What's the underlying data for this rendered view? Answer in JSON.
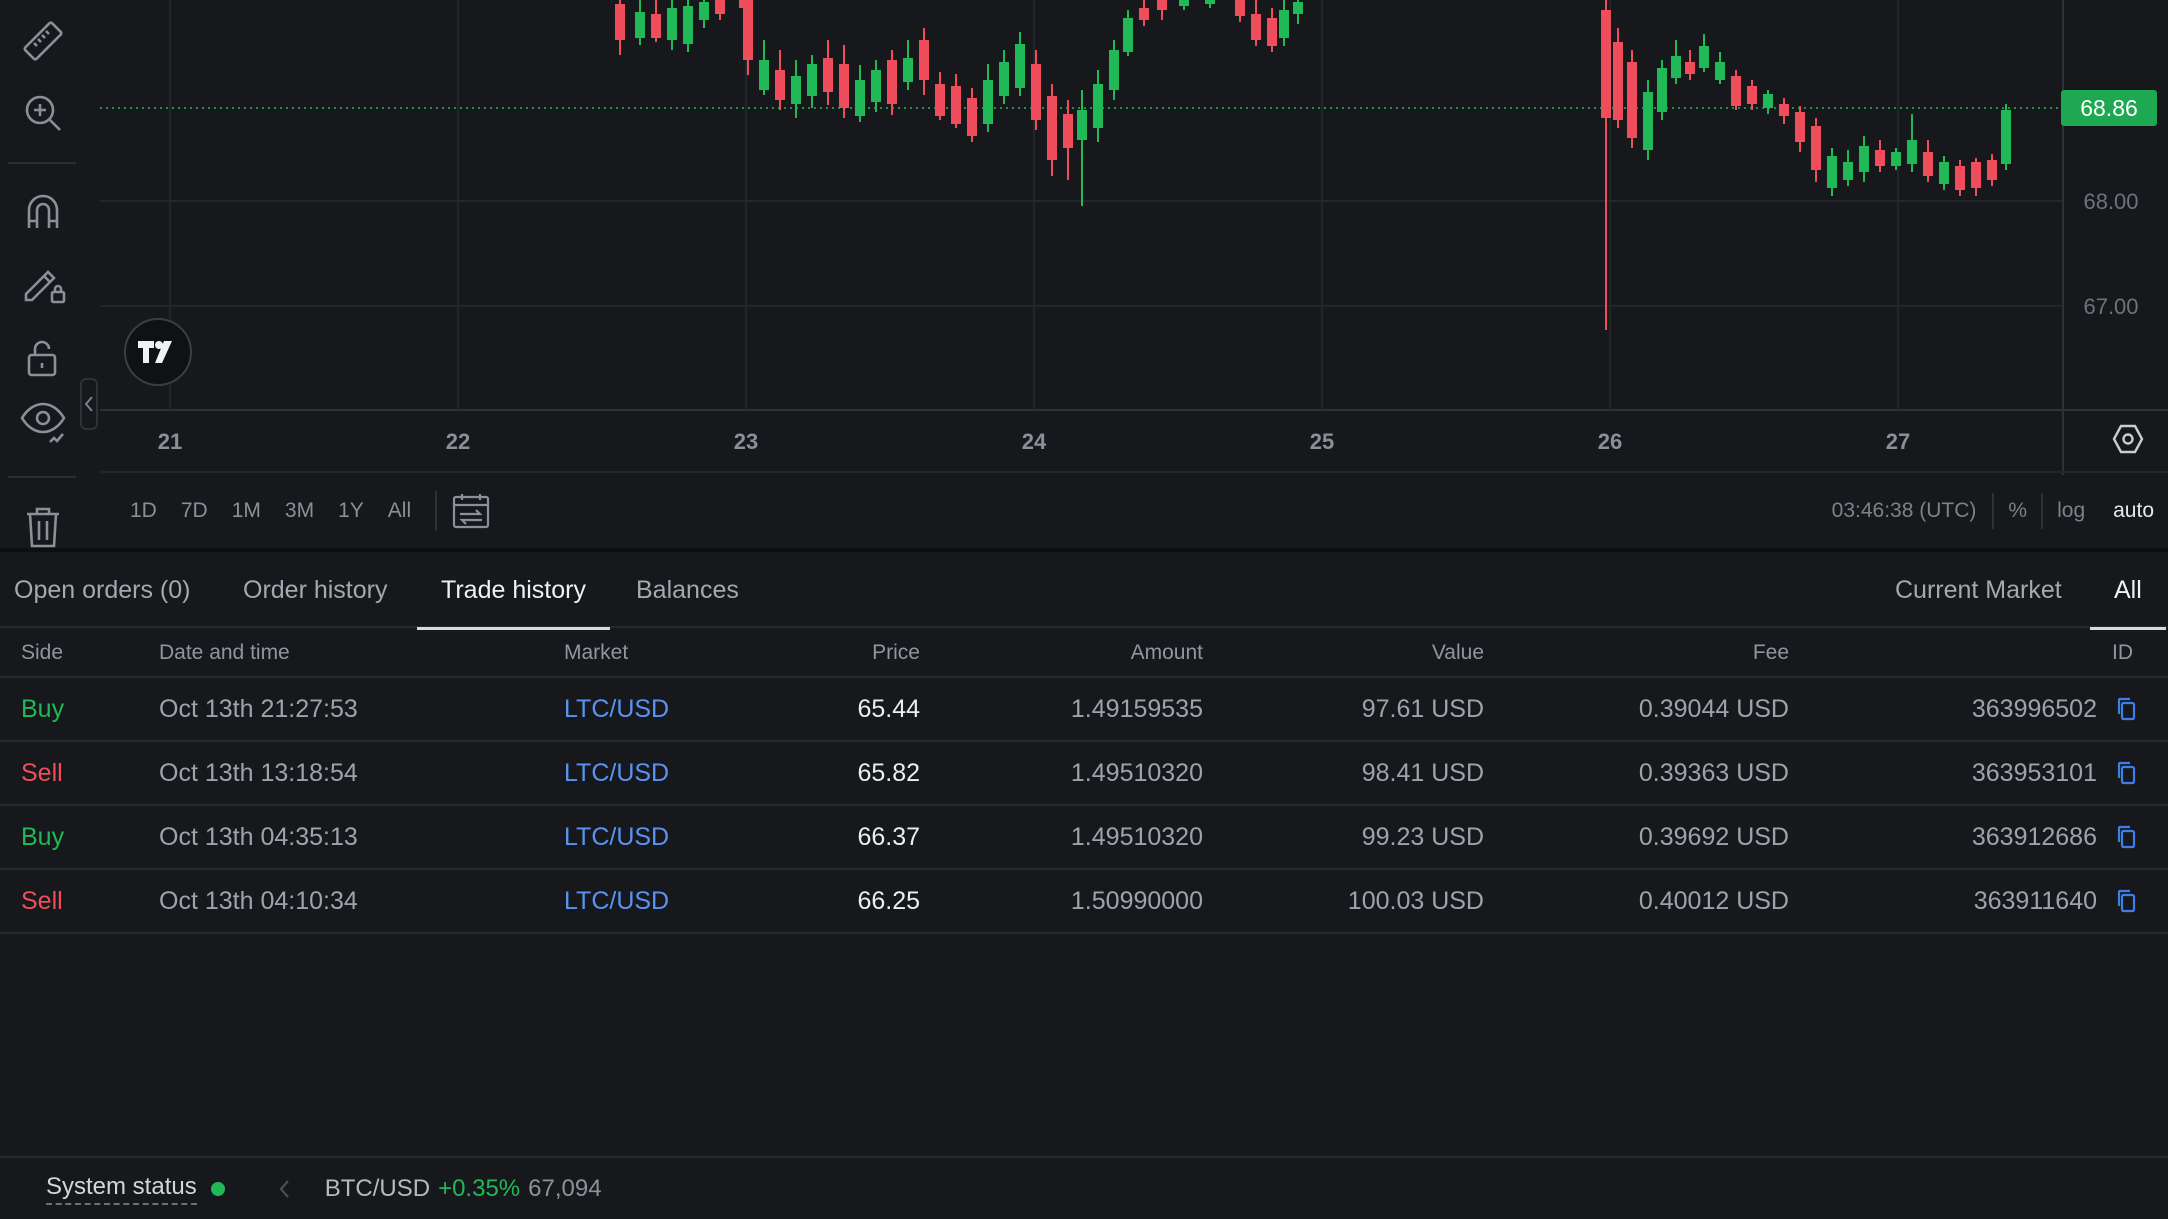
{
  "chart": {
    "x_ticks": [
      "21",
      "22",
      "23",
      "24",
      "25",
      "26",
      "27"
    ],
    "y_ticks": [
      "68.00",
      "67.00"
    ],
    "last_price": "68.86",
    "time_ranges": [
      "1D",
      "7D",
      "1M",
      "3M",
      "1Y",
      "All"
    ],
    "clock": "03:46:38 (UTC)",
    "scale_options": {
      "percent": "%",
      "log": "log",
      "auto": "auto"
    },
    "colors": {
      "up": "#21b857",
      "down": "#ef4d5b",
      "last_price_bg": "#1ea852"
    }
  },
  "tabs": {
    "open_orders": "Open orders (0)",
    "order_history": "Order history",
    "trade_history": "Trade history",
    "balances": "Balances",
    "current_market": "Current Market",
    "all": "All"
  },
  "table": {
    "headers": {
      "side": "Side",
      "date": "Date and time",
      "market": "Market",
      "price": "Price",
      "amount": "Amount",
      "value": "Value",
      "fee": "Fee",
      "id": "ID"
    },
    "rows": [
      {
        "side": "Buy",
        "date": "Oct 13th 21:27:53",
        "market": "LTC/USD",
        "price": "65.44",
        "amount": "1.49159535",
        "value": "97.61 USD",
        "fee": "0.39044 USD",
        "id": "363996502"
      },
      {
        "side": "Sell",
        "date": "Oct 13th 13:18:54",
        "market": "LTC/USD",
        "price": "65.82",
        "amount": "1.49510320",
        "value": "98.41 USD",
        "fee": "0.39363 USD",
        "id": "363953101"
      },
      {
        "side": "Buy",
        "date": "Oct 13th 04:35:13",
        "market": "LTC/USD",
        "price": "66.37",
        "amount": "1.49510320",
        "value": "99.23 USD",
        "fee": "0.39692 USD",
        "id": "363912686"
      },
      {
        "side": "Sell",
        "date": "Oct 13th 04:10:34",
        "market": "LTC/USD",
        "price": "66.25",
        "amount": "1.50990000",
        "value": "100.03 USD",
        "fee": "0.40012 USD",
        "id": "363911640"
      }
    ]
  },
  "status": {
    "label": "System status",
    "pair": "BTC/USD",
    "change": "+0.35%",
    "price": "67,094"
  }
}
